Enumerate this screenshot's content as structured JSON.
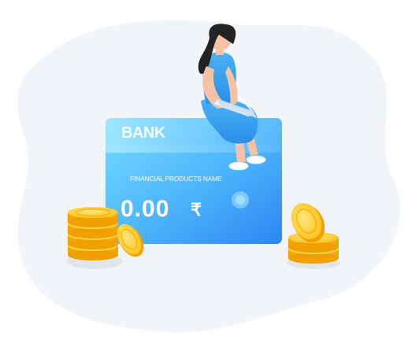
{
  "card": {
    "bank_label": "BANK",
    "product_name": "FINANCIAL PRODUCTS NAME",
    "amount": "0.00",
    "currency_symbol": "₹"
  },
  "colors": {
    "card_light": "#6fd3ff",
    "card_dark": "#2f8ff5",
    "blob": "#f1f4f8",
    "coin": "#ffc21a",
    "coin_dark": "#f0a300",
    "dress": "#3aa4ef",
    "hair": "#232323"
  }
}
